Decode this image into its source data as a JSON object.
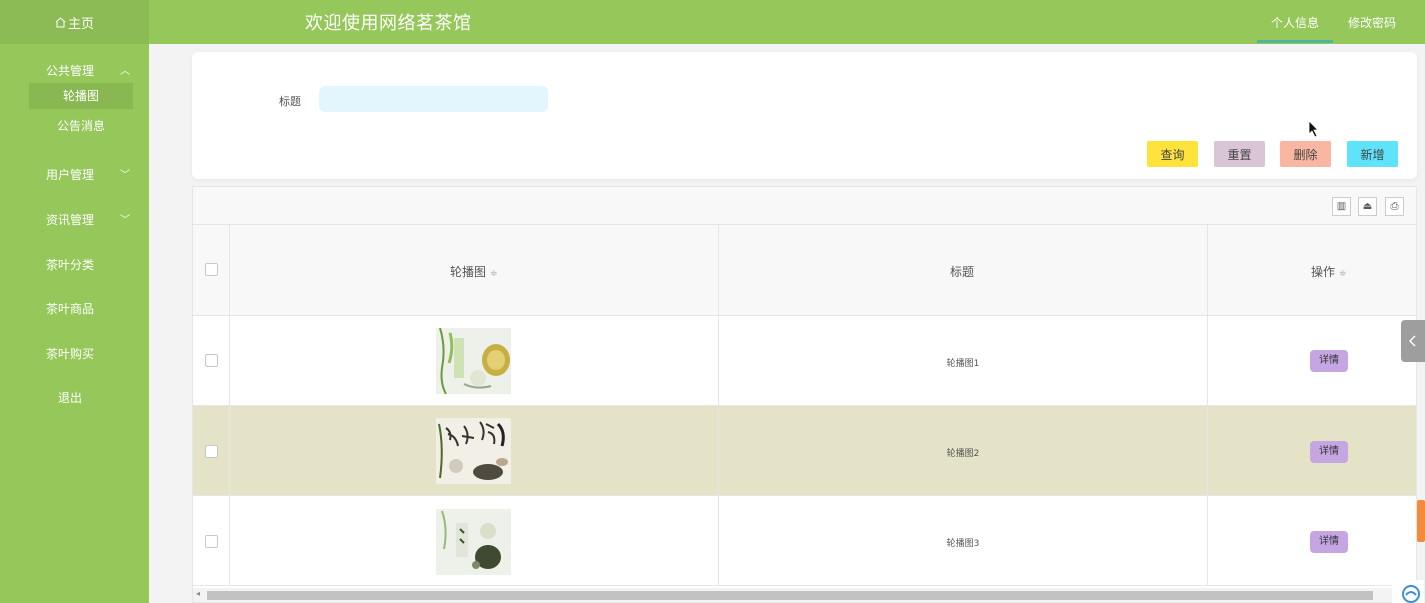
{
  "header": {
    "home_label": "主页",
    "home_icon": "home-icon",
    "site_title": "欢迎使用网络茗茶馆",
    "links": [
      "个人信息",
      "修改密码"
    ],
    "colors": {
      "bar": "#95c75a",
      "accent": "#4db6a0"
    }
  },
  "sidebar": {
    "groups": [
      {
        "label": "公共管理",
        "chevron": "︿",
        "items": [
          "轮播图",
          "公告消息"
        ]
      },
      {
        "label": "用户管理",
        "chevron": "﹀"
      },
      {
        "label": "资讯管理",
        "chevron": "﹀"
      },
      {
        "label": "茶叶分类"
      },
      {
        "label": "茶叶商品"
      },
      {
        "label": "茶叶购买"
      },
      {
        "label": "退出"
      }
    ]
  },
  "search": {
    "label": "标题",
    "placeholder": "",
    "buttons": {
      "query": "查询",
      "reset": "重置",
      "delete": "删除",
      "add": "新增"
    },
    "button_colors": {
      "query": "#ffe23b",
      "reset": "#d9c5d5",
      "delete": "#f9b6a2",
      "add": "#5ee3fb"
    }
  },
  "table": {
    "columns": [
      "轮播图",
      "标题",
      "操作"
    ],
    "rows": [
      {
        "title": "轮播图1",
        "action": "详情"
      },
      {
        "title": "轮播图2",
        "action": "详情"
      },
      {
        "title": "轮播图3",
        "action": "详情"
      }
    ],
    "toolbar_icons": [
      "columns-icon",
      "export-icon",
      "print-icon"
    ],
    "highlight_color": "#e4e2c7"
  }
}
